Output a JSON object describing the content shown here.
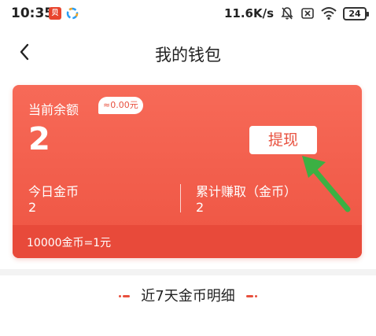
{
  "status_bar": {
    "time": "10:35",
    "app_icon_label": "贝",
    "net_speed": "11.6K/s",
    "battery": "24"
  },
  "nav": {
    "title": "我的钱包"
  },
  "wallet": {
    "balance_label": "当前余额",
    "approx_badge": "≈0.00元",
    "balance_value": "2",
    "withdraw_label": "提现",
    "today_coins_label": "今日金币",
    "today_coins_value": "2",
    "total_earned_label": "累计赚取（金币）",
    "total_earned_value": "2",
    "exchange_rate": "10000金币=1元"
  },
  "colors": {
    "card_top": "#f76a58",
    "card_bottom": "#ee5442",
    "footer": "#e84a3a",
    "accent_red": "#e8503e",
    "arrow_green": "#3cb043"
  },
  "icons": {
    "back": "chevron-left-icon",
    "mute": "bell-off-icon",
    "sim": "sim-x-icon",
    "wifi": "wifi-icon"
  },
  "section": {
    "title": "近7天金币明细"
  }
}
